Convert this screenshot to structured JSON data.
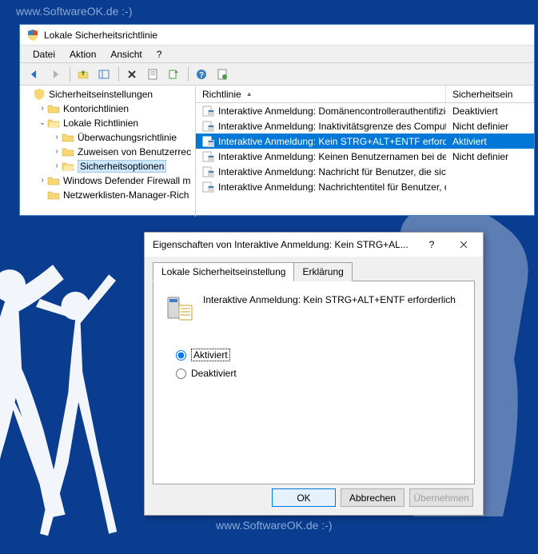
{
  "watermark_text": "www.SoftwareOK.de :-)",
  "mmc": {
    "title": "Lokale Sicherheitsrichtlinie",
    "menu": {
      "file": "Datei",
      "action": "Aktion",
      "view": "Ansicht",
      "help": "?"
    },
    "tree": {
      "root": "Sicherheitseinstellungen",
      "items": [
        {
          "label": "Kontorichtlinien",
          "expand": ">"
        },
        {
          "label": "Lokale Richtlinien",
          "expand": "v",
          "children": [
            {
              "label": "Überwachungsrichtlinie",
              "expand": ">"
            },
            {
              "label": "Zuweisen von Benutzerrec",
              "expand": ">"
            },
            {
              "label": "Sicherheitsoptionen",
              "expand": ">",
              "selected": true
            }
          ]
        },
        {
          "label": "Windows Defender Firewall m",
          "expand": ">"
        },
        {
          "label": "Netzwerklisten-Manager-Rich",
          "expand": ""
        }
      ]
    },
    "list": {
      "col_policy": "Richtlinie",
      "col_setting": "Sicherheitsein",
      "rows": [
        {
          "policy": "Interaktive Anmeldung: Domänencontrollerauthentifizierun...",
          "setting": "Deaktiviert"
        },
        {
          "policy": "Interaktive Anmeldung: Inaktivitätsgrenze des Computers",
          "setting": "Nicht definier"
        },
        {
          "policy": "Interaktive Anmeldung: Kein STRG+ALT+ENTF erforderlich",
          "setting": "Aktiviert",
          "selected": true
        },
        {
          "policy": "Interaktive Anmeldung: Keinen Benutzernamen bei der Anm...",
          "setting": "Nicht definier"
        },
        {
          "policy": "Interaktive Anmeldung: Nachricht für Benutzer, die sich an...",
          "setting": ""
        },
        {
          "policy": "Interaktive Anmeldung: Nachrichtentitel für Benutzer, die si...",
          "setting": ""
        }
      ]
    }
  },
  "dialog": {
    "title": "Eigenschaften von Interaktive Anmeldung: Kein STRG+AL...",
    "tabs": {
      "local": "Lokale Sicherheitseinstellung",
      "explain": "Erklärung"
    },
    "policy_name": "Interaktive Anmeldung: Kein STRG+ALT+ENTF erforderlich",
    "radio_enabled": "Aktiviert",
    "radio_disabled": "Deaktiviert",
    "buttons": {
      "ok": "OK",
      "cancel": "Abbrechen",
      "apply": "Übernehmen"
    }
  }
}
